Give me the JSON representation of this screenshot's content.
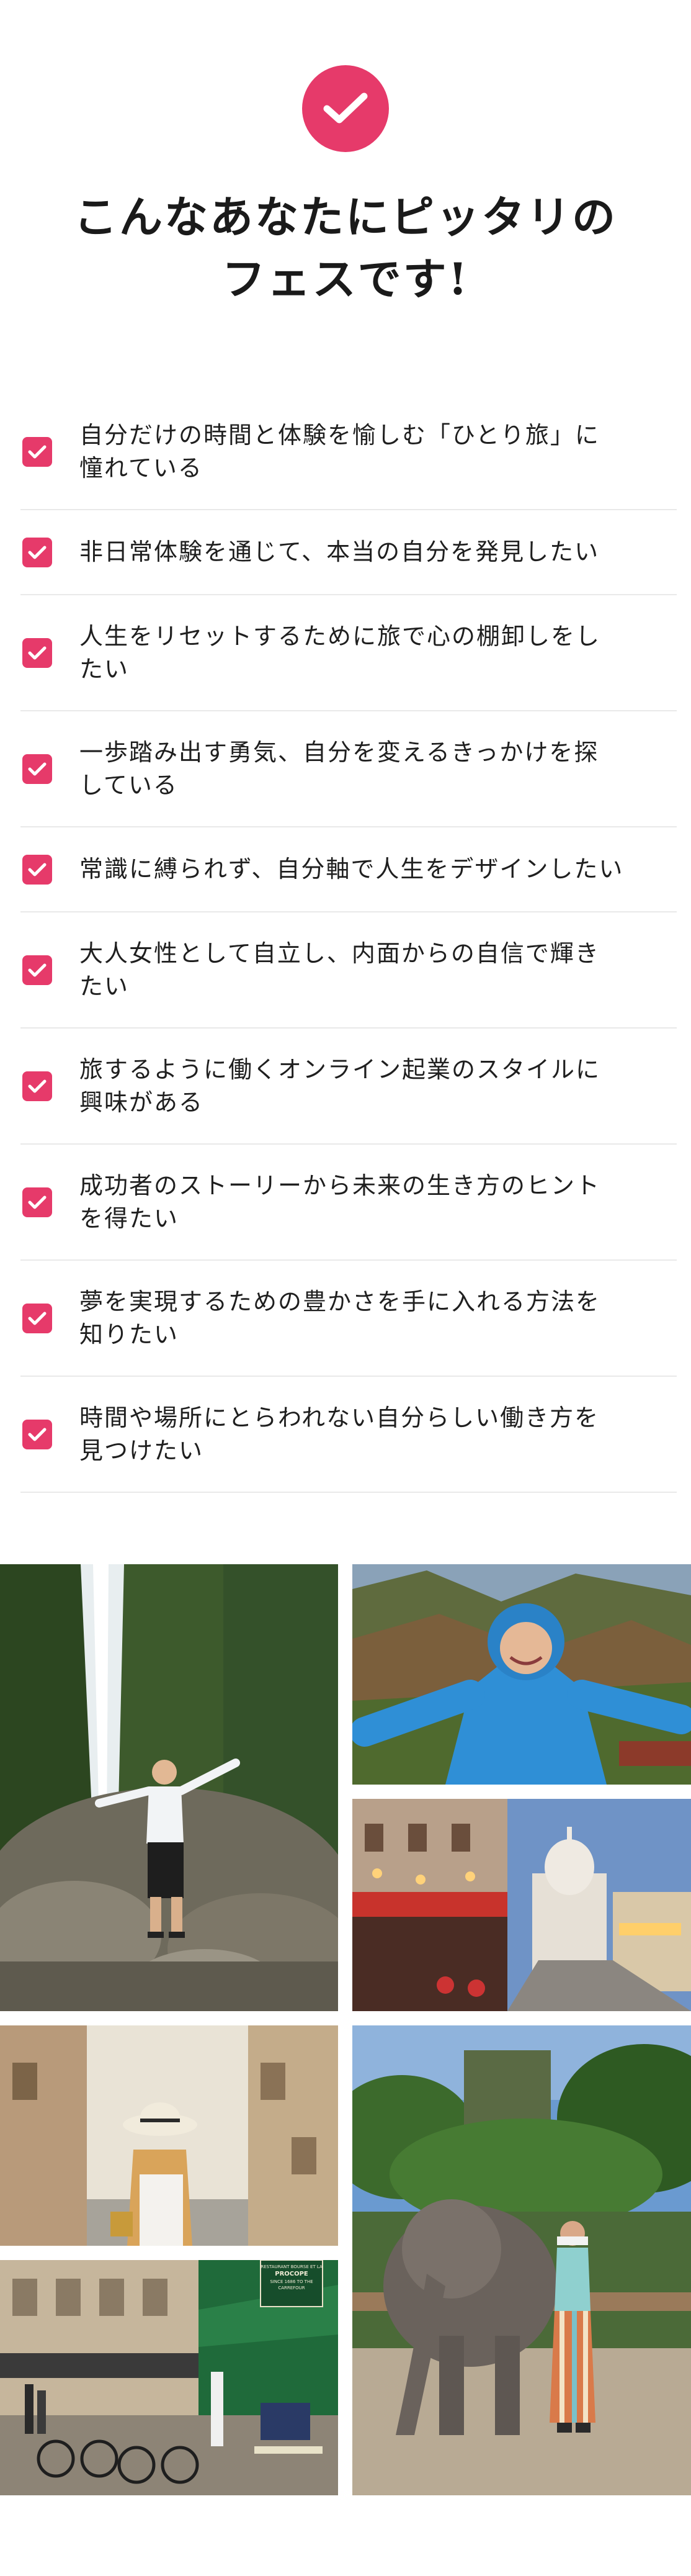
{
  "hero": {
    "icon": "check-circle-icon",
    "title_line1": "こんなあなたにピッタリの",
    "title_line2": "フェスです!"
  },
  "colors": {
    "accent": "#e63a6a",
    "divider": "#e9e9e9",
    "text": "#1f1f1f"
  },
  "checklist": {
    "icon": "checkbox-checked-icon",
    "items": [
      {
        "line1": "自分だけの時間と体験を愉しむ「ひとり旅」に",
        "line2": "憧れている"
      },
      {
        "line1": "非日常体験を通じて、本当の自分を発見したい",
        "line2": ""
      },
      {
        "line1": "人生をリセットするために旅で心の棚卸しをし",
        "line2": "たい"
      },
      {
        "line1": "一歩踏み出す勇気、自分を変えるきっかけを探",
        "line2": "している"
      },
      {
        "line1": "常識に縛られず、自分軸で人生をデザインしたい",
        "line2": ""
      },
      {
        "line1": "大人女性として自立し、内面からの自信で輝き",
        "line2": "たい"
      },
      {
        "line1": "旅するように働くオンライン起業のスタイルに",
        "line2": "興味がある"
      },
      {
        "line1": "成功者のストーリーから未来の生き方のヒント",
        "line2": "を得たい"
      },
      {
        "line1": "夢を実現するための豊かさを手に入れる方法を",
        "line2": "知りたい"
      },
      {
        "line1": "時間や場所にとらわれない自分らしい働き方を",
        "line2": "見つけたい"
      }
    ]
  },
  "gallery": {
    "photos": [
      "waterfall-traveler-photo",
      "hooded-hiker-photo",
      "paris-montmartre-street-photo",
      "alley-woman-straw-hat-photo",
      "elephant-traveler-photo",
      "paris-cafe-bicycles-photo"
    ],
    "signs": {
      "cafe_sign_line1": "RESTAURANT BOURSE ET LA",
      "cafe_sign_line2": "PROCOPE",
      "cafe_sign_line3": "SINCE 1686 TO THE",
      "cafe_sign_line4": "CARREFOUR"
    }
  }
}
